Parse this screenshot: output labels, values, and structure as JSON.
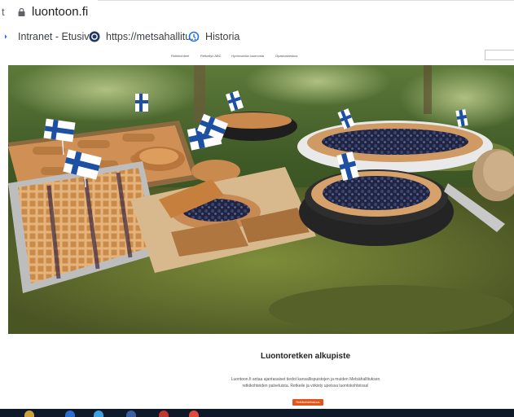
{
  "browser": {
    "url": "luontoon.fi",
    "cut_left_glyph": "t"
  },
  "bookmarks": [
    {
      "label": "Intranet - Etusivu",
      "icon": "play-icon"
    },
    {
      "label": "https://metsahallitu...",
      "icon": "globe-icon"
    },
    {
      "label": "Historia",
      "icon": "history-icon"
    }
  ],
  "site_nav": {
    "links": [
      "Retkikohteet",
      "Retkeilyn ABC",
      "Hyvinvointia luonnosta",
      "Opastuskeskus"
    ]
  },
  "hero": {
    "alt_icon": "hero-photo-pies-finnish-flags"
  },
  "content": {
    "heading": "Luontoretken alkupiste",
    "description": "Luontoon.fi antaa ajantasaiset tiedot kansallispuistojen ja muiden Metsähallituksen retkikohteiden palveluista. Retkeile ja virkisty upeissa luontokohteissa!",
    "cta_label": "Retkikohdehakuun"
  },
  "colors": {
    "accent": "#e0561c",
    "taskbar": "#0e1a2a"
  }
}
